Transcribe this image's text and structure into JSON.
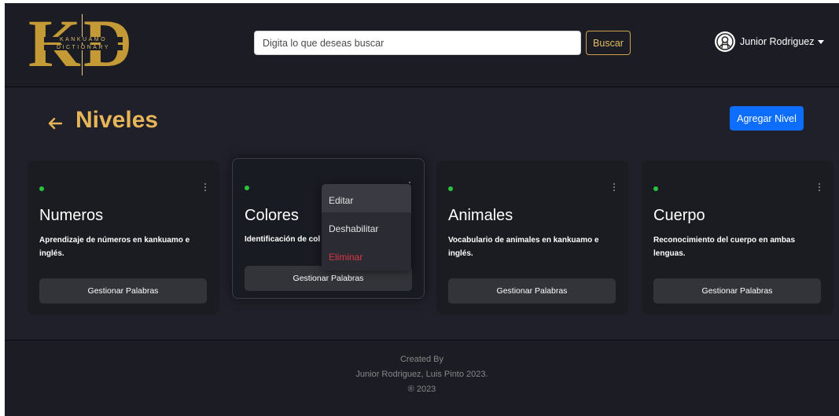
{
  "header": {
    "logo": {
      "letters": "KD",
      "subtitle_line1": "KANKUAMO",
      "subtitle_line2": "DICTIONARY"
    },
    "search": {
      "placeholder": "Digita lo que deseas buscar",
      "button_label": "Buscar"
    },
    "user": {
      "name": "Junior Rodriguez"
    }
  },
  "page": {
    "title": "Niveles",
    "add_button_label": "Agregar Nivel"
  },
  "cards": [
    {
      "title": "Numeros",
      "description": "Aprendizaje de números en kankuamo e inglés.",
      "button_label": "Gestionar Palabras",
      "status_color": "#2bc23f"
    },
    {
      "title": "Colores",
      "description": "Identificación de col",
      "button_label": "Gestionar Palabras",
      "status_color": "#2bc23f"
    },
    {
      "title": "Animales",
      "description": "Vocabulario de animales en kankuamo e inglés.",
      "button_label": "Gestionar Palabras",
      "status_color": "#2bc23f"
    },
    {
      "title": "Cuerpo",
      "description": "Reconocimiento del cuerpo en ambas lenguas.",
      "button_label": "Gestionar Palabras",
      "status_color": "#2bc23f"
    }
  ],
  "dropdown": {
    "items": [
      {
        "label": "Editar",
        "color": "#e4e4e4"
      },
      {
        "label": "Deshabilitar",
        "color": "#e4e4e4"
      },
      {
        "label": "Eliminar",
        "color": "#dc3545"
      }
    ]
  },
  "footer": {
    "line1": "Created By",
    "line2": "Junior Rodriguez, Luis Pinto 2023.",
    "line3": "® 2023"
  },
  "colors": {
    "background": "#1f2029",
    "accent_gold": "#e7b559",
    "primary_blue": "#0d6efd",
    "danger_red": "#dc3545",
    "status_green": "#2bc23f"
  },
  "icons": {
    "back": "arrow-left-icon",
    "user": "user-avatar-icon",
    "menu": "kebab-icon"
  }
}
